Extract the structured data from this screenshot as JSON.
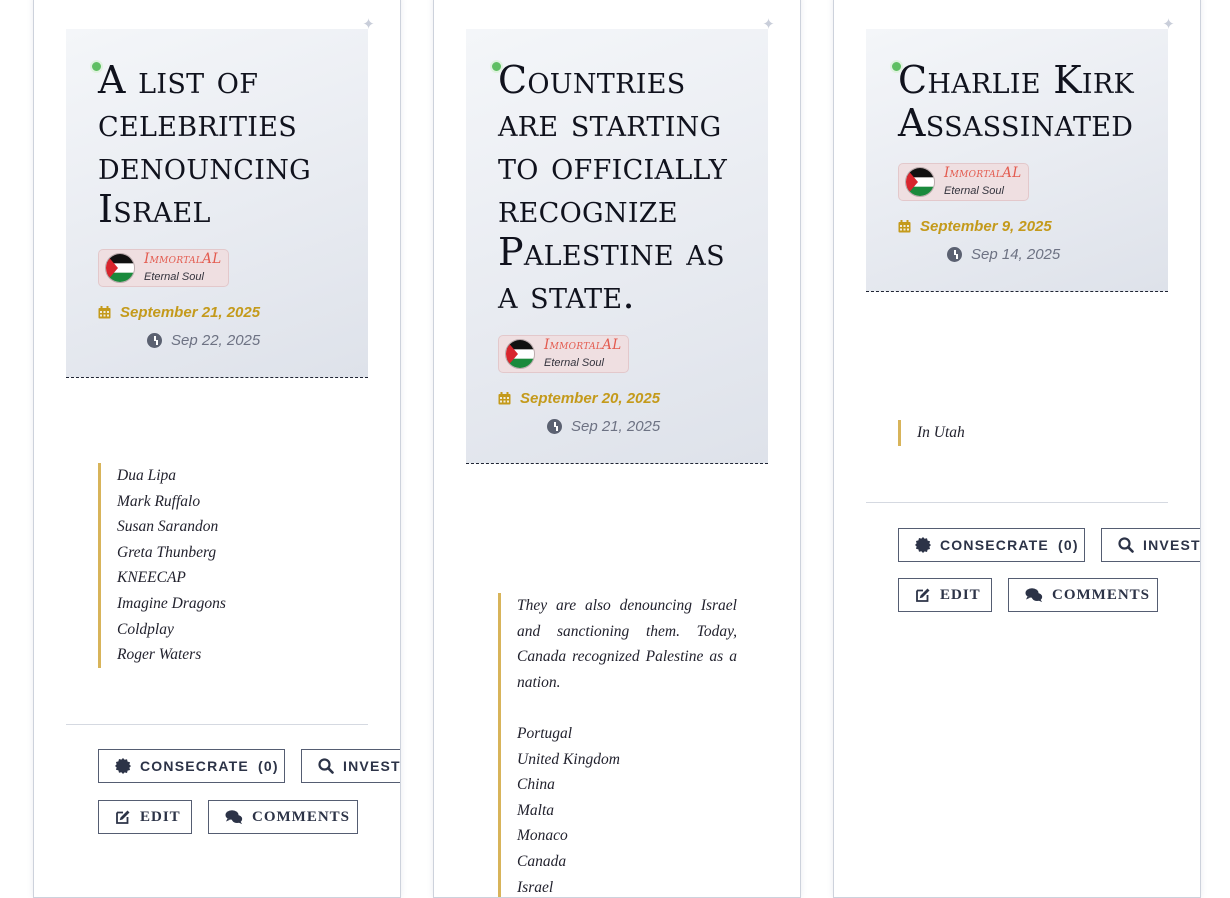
{
  "cards": [
    {
      "title": "A list of celebrities denouncing Israel",
      "author": {
        "name": "ImmortalAL",
        "rank": "Eternal Soul"
      },
      "date_posted": "September 21, 2025",
      "date_updated": "Sep 22, 2025",
      "body_lines": [
        "Dua Lipa",
        "Mark Ruffalo",
        "Susan Sarandon",
        "Greta Thunberg",
        "KNEECAP",
        "Imagine Dragons",
        "Coldplay",
        "Roger Waters"
      ],
      "consecrate_label": "CONSECRATE",
      "consecrate_count": "(0)",
      "investigate_label": "INVESTI",
      "edit_label": "EDIT",
      "comments_label": "COMMENTS"
    },
    {
      "title": "Countries are starting to officially recognize Palestine as a state.",
      "author": {
        "name": "ImmortalAL",
        "rank": "Eternal Soul"
      },
      "date_posted": "September 20, 2025",
      "date_updated": "Sep 21, 2025",
      "body_intro": "They are also denouncing Israel and sanctioning them. Today, Canada recognized Palestine as a nation.",
      "body_lines": [
        "Portugal",
        "United Kingdom",
        "China",
        "Malta",
        "Monaco",
        "Canada",
        "Israel"
      ]
    },
    {
      "title": "Charlie Kirk Assassinated",
      "author": {
        "name": "ImmortalAL",
        "rank": "Eternal Soul"
      },
      "date_posted": "September 9, 2025",
      "date_updated": "Sep 14, 2025",
      "body_lines": [
        "In Utah"
      ],
      "consecrate_label": "CONSECRATE",
      "consecrate_count": "(0)",
      "investigate_label": "INVESTI",
      "edit_label": "EDIT",
      "comments_label": "COMMENTS"
    }
  ],
  "icons": {
    "sparkle": "sparkle-icon",
    "calendar": "calendar-icon",
    "clock": "clock-icon",
    "consecrate": "badge-icon",
    "investigate": "search-icon",
    "edit": "edit-icon",
    "comments": "comments-icon"
  },
  "colors": {
    "date_accent": "#c49a1b",
    "author_name": "#e35a4e",
    "quote_border": "#d8b45a",
    "online_dot": "#5fbf62"
  }
}
